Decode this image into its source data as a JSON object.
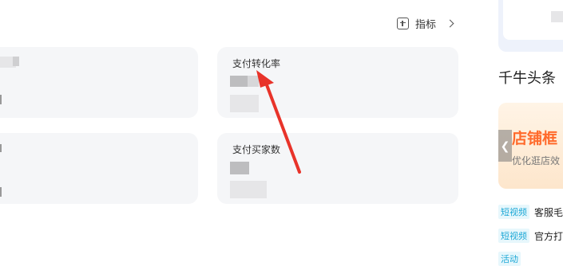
{
  "toolbar": {
    "add_metric_label": "指标"
  },
  "cards": [
    {
      "title": ""
    },
    {
      "title": "支付转化率"
    },
    {
      "title": ""
    },
    {
      "title": "支付买家数"
    }
  ],
  "right_panel": {
    "section_title": "千牛头条",
    "banner": {
      "headline": "店铺框",
      "subline": "优化逛店效"
    },
    "news": [
      {
        "tag": "短视频",
        "text": "客服毛"
      },
      {
        "tag": "短视频",
        "text": "官方打"
      },
      {
        "tag": "活动",
        "text": ""
      }
    ]
  },
  "colors": {
    "accent_arrow": "#e8332a",
    "tag_blue": "#1da8d6",
    "banner_orange": "#ff6a2b"
  }
}
